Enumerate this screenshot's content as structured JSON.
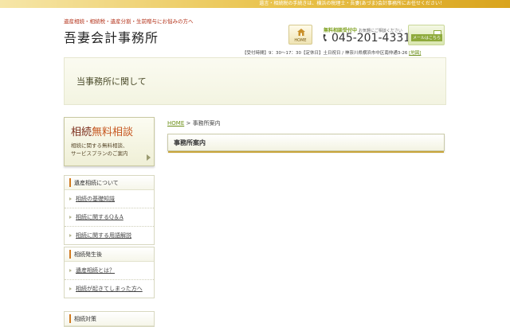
{
  "top_bar": {
    "notice": "遺言・相続税の手続きは、横浜の税理士・吾妻(あづま)会計事務所にお任せください！"
  },
  "header": {
    "tagline": "遺産相続・相続税・遺産分割・生前贈与にお悩みの方へ",
    "logo": "吾妻会計事務所",
    "home_button": "HOME",
    "free_consult_label": "無料相談受付中",
    "free_consult_sub": "お気軽にご相談ください",
    "phone": "045-201-4331",
    "mail_button": "メールはこちら",
    "info_line": "【受付時間】9：30～17：30【定休日】土日祝日 / 神奈川県横浜市中区南仲通3-26",
    "map_link": "[地図]"
  },
  "hero": {
    "title": "当事務所に関して"
  },
  "sidebar": {
    "banner": {
      "line1_a": "相続",
      "line1_b": "無料相談",
      "line2": "相続に関する無料相談、",
      "line3": "サービスプランのご案内"
    },
    "sections": [
      {
        "heading": "遺産相続について",
        "items": [
          "相続の基礎知識",
          "相続に関するQ＆A",
          "相続に関する用語解説"
        ]
      },
      {
        "heading": "相続発生後",
        "items": [
          "遺産相続とは？",
          "相続が起きてしまった方へ"
        ]
      },
      {
        "heading": "相続対策",
        "items": []
      }
    ]
  },
  "breadcrumb": {
    "home": "HOME",
    "separator": " > ",
    "current": "事務所案内"
  },
  "page": {
    "title": "事務所案内"
  },
  "colors": {
    "accent_orange": "#d07a1f",
    "link_green": "#6b8e16",
    "gold": "#e9c24a"
  }
}
